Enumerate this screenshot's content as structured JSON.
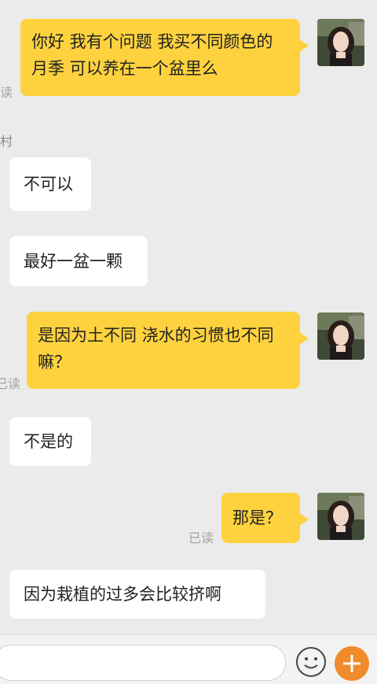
{
  "app": {
    "accent_color": "#fdd23e",
    "plus_color": "#f08a2b"
  },
  "header": {
    "sender_name_fragment": "村"
  },
  "messages": [
    {
      "direction": "out",
      "text": "你好 我有个问题 我买不同颜色的月季 可以养在一个盆里么",
      "status": "读"
    },
    {
      "direction": "in",
      "text": "不可以"
    },
    {
      "direction": "in",
      "text": "最好一盆一颗"
    },
    {
      "direction": "out",
      "text": "是因为土不同 浇水的习惯也不同嘛？",
      "status": "已读"
    },
    {
      "direction": "in",
      "text": "不是的"
    },
    {
      "direction": "out",
      "text": "那是？",
      "status": "已读"
    },
    {
      "direction": "in",
      "text": "因为栽植的过多会比较挤啊"
    }
  ],
  "input_bar": {
    "emoji_icon": "smile-icon",
    "plus_icon": "plus-icon"
  }
}
